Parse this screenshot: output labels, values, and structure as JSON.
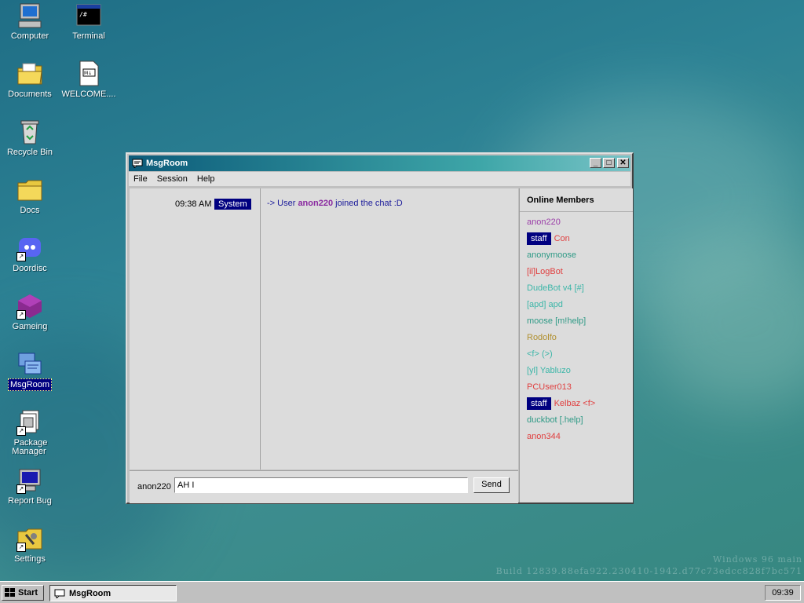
{
  "desktop": {
    "icons": [
      {
        "label": "Computer",
        "icon": "computer-icon"
      },
      {
        "label": "Terminal",
        "icon": "terminal-icon"
      },
      {
        "label": "Documents",
        "icon": "documents-folder-icon"
      },
      {
        "label": "WELCOME....",
        "icon": "markdown-file-icon"
      },
      {
        "label": "Recycle Bin",
        "icon": "recycle-bin-icon"
      },
      {
        "label": "Docs",
        "icon": "folder-icon"
      },
      {
        "label": "Doordisc",
        "icon": "doordisc-icon"
      },
      {
        "label": "Gameing",
        "icon": "gameing-icon"
      },
      {
        "label": "MsgRoom",
        "icon": "msgroom-icon"
      },
      {
        "label": "Package Manager",
        "icon": "package-manager-icon"
      },
      {
        "label": "Report Bug",
        "icon": "report-bug-icon"
      },
      {
        "label": "Settings",
        "icon": "settings-icon"
      }
    ],
    "watermark_line1": "Windows 96 main",
    "watermark_line2": "Build 12839.88efa922.230410-1942.d77c73edcc828f7bc571"
  },
  "window": {
    "title": "MsgRoom",
    "controls": {
      "minimize": "_",
      "maximize": "□",
      "close": "✕"
    },
    "menu": [
      "File",
      "Session",
      "Help"
    ],
    "messages": [
      {
        "time": "09:38 AM",
        "badge": "System",
        "prefix": "-> User ",
        "user": "anon220",
        "suffix": " joined the chat :D"
      }
    ],
    "members_title": "Online Members",
    "members": [
      {
        "tag": "",
        "name": "anon220",
        "color": "#9b3fa8"
      },
      {
        "tag": "staff",
        "name": "Con",
        "color": "#e04040"
      },
      {
        "tag": "",
        "name": "anonymoose",
        "color": "#2f9a86"
      },
      {
        "tag": "",
        "name": "[il]LogBot",
        "color": "#e04040"
      },
      {
        "tag": "",
        "name": "DudeBot v4 [#]",
        "color": "#3cb6a8"
      },
      {
        "tag": "",
        "name": "[apd] apd",
        "color": "#3cb6a8"
      },
      {
        "tag": "",
        "name": "moose [m!help]",
        "color": "#2f9a86"
      },
      {
        "tag": "",
        "name": "Rodolfo",
        "color": "#b09030"
      },
      {
        "tag": "",
        "name": "<f> (>)",
        "color": "#3cb6a8"
      },
      {
        "tag": "",
        "name": "[yl] Yabluzo",
        "color": "#3cb6a8"
      },
      {
        "tag": "",
        "name": "PCUser013",
        "color": "#e04040"
      },
      {
        "tag": "staff",
        "name": "Kelbaz <f>",
        "color": "#e04040"
      },
      {
        "tag": "",
        "name": "duckbot [.help]",
        "color": "#2f9a86"
      },
      {
        "tag": "",
        "name": "anon344",
        "color": "#e04040"
      }
    ],
    "input": {
      "username": "anon220",
      "value": "AH I",
      "send_label": "Send"
    }
  },
  "taskbar": {
    "start_label": "Start",
    "task_label": "MsgRoom",
    "clock": "09:39"
  }
}
